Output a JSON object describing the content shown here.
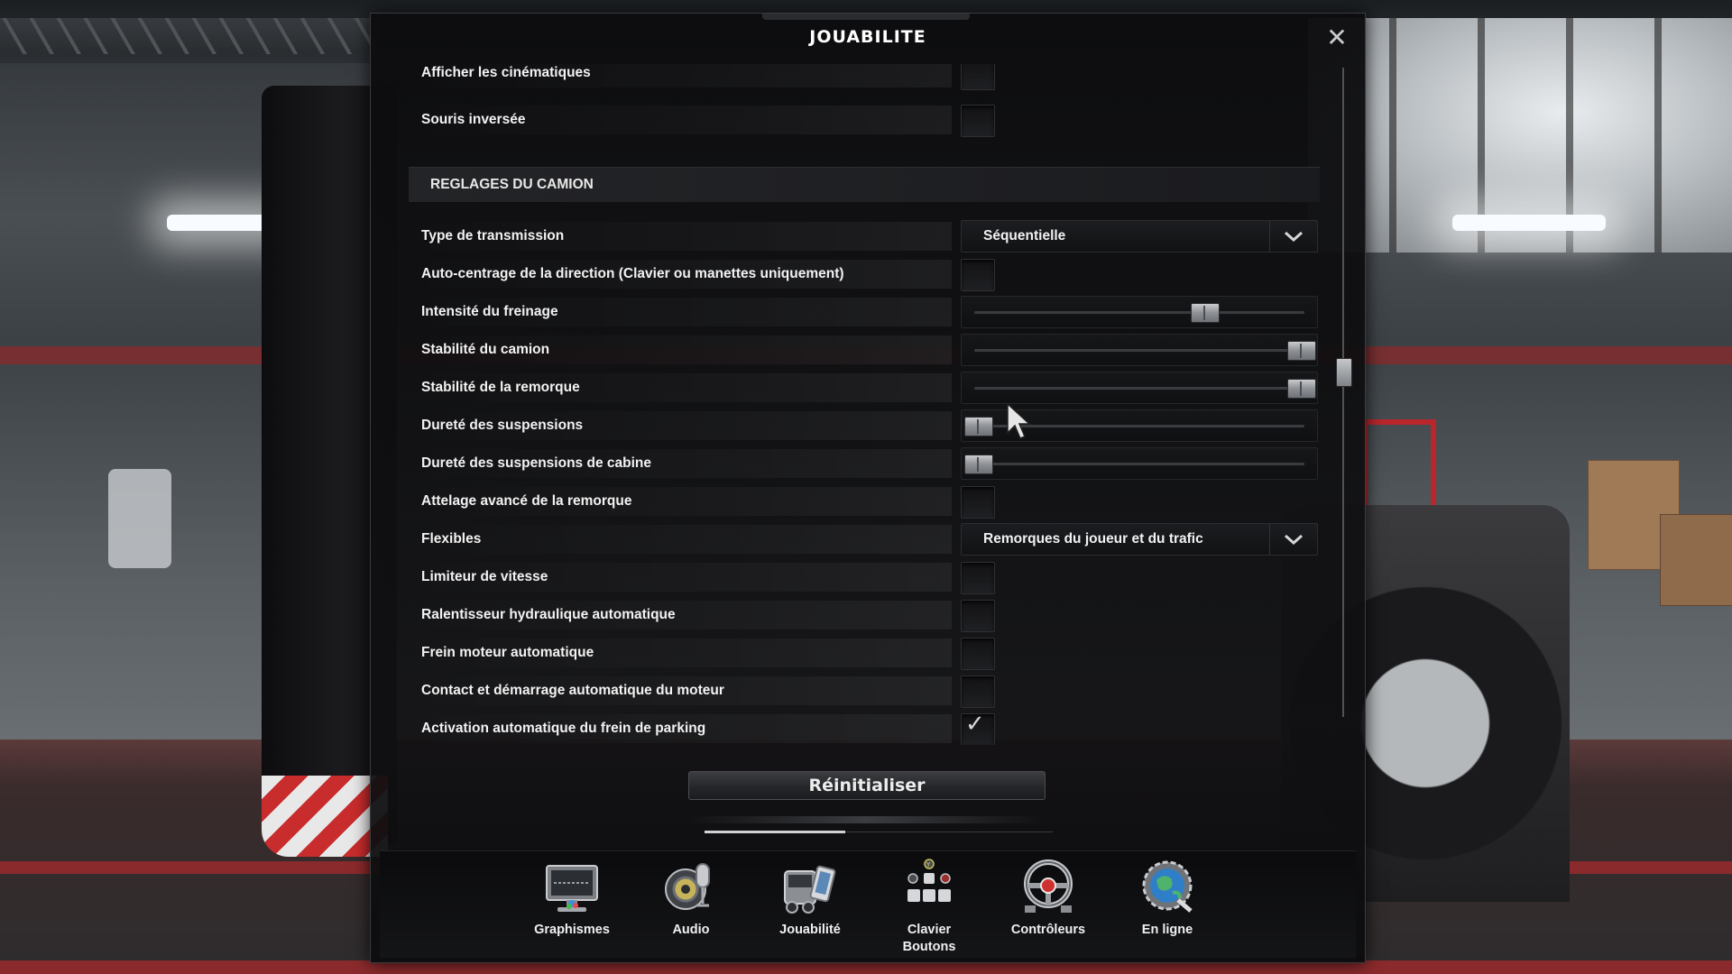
{
  "panel": {
    "title": "JOUABILITE",
    "close_symbol": "✕"
  },
  "rows_top": [
    {
      "label": "Afficher les cinématiques",
      "control": "checkbox",
      "checked": false
    },
    {
      "label": "Souris inversée",
      "control": "checkbox",
      "checked": false
    }
  ],
  "section": {
    "title": "REGLAGES DU CAMION"
  },
  "rows": [
    {
      "label": "Type de transmission",
      "control": "dropdown",
      "value": "Séquentielle"
    },
    {
      "label": "Auto-centrage de la direction (Clavier ou manettes uniquement)",
      "control": "checkbox",
      "checked": false
    },
    {
      "label": "Intensité du freinage",
      "control": "slider",
      "level": 0.7
    },
    {
      "label": "Stabilité du camion",
      "control": "slider",
      "level": 1.0
    },
    {
      "label": "Stabilité de la remorque",
      "control": "slider",
      "level": 1.0
    },
    {
      "label": "Dureté des suspensions",
      "control": "slider",
      "level": 0.0
    },
    {
      "label": "Dureté des suspensions de cabine",
      "control": "slider",
      "level": 0.0
    },
    {
      "label": "Attelage avancé de la remorque",
      "control": "checkbox",
      "checked": false
    },
    {
      "label": "Flexibles",
      "control": "dropdown",
      "value": "Remorques du joueur et du trafic"
    },
    {
      "label": "Limiteur de vitesse",
      "control": "checkbox",
      "checked": false
    },
    {
      "label": "Ralentisseur hydraulique automatique",
      "control": "checkbox",
      "checked": false
    },
    {
      "label": "Frein moteur automatique",
      "control": "checkbox",
      "checked": false
    },
    {
      "label": "Contact et démarrage automatique du moteur",
      "control": "checkbox",
      "checked": false
    },
    {
      "label": "Activation automatique du frein de parking",
      "control": "checkbox",
      "checked": true
    }
  ],
  "reset_button": {
    "label": "Réinitialiser"
  },
  "nav": {
    "items": [
      {
        "label": "Graphismes",
        "icon": "monitor-icon"
      },
      {
        "label": "Audio",
        "icon": "speaker-microphone-icon"
      },
      {
        "label": "Jouabilité",
        "icon": "truck-phone-icon"
      },
      {
        "label": "Clavier\nBoutons",
        "icon": "keyboard-gamepad-icon"
      },
      {
        "label": "Contrôleurs",
        "icon": "steering-wheel-icon"
      },
      {
        "label": "En ligne",
        "icon": "globe-gear-icon"
      }
    ]
  },
  "colors": {
    "panel_bg": "#0e0e10",
    "text": "#f2f2f2",
    "accent_red": "#b9272c"
  }
}
